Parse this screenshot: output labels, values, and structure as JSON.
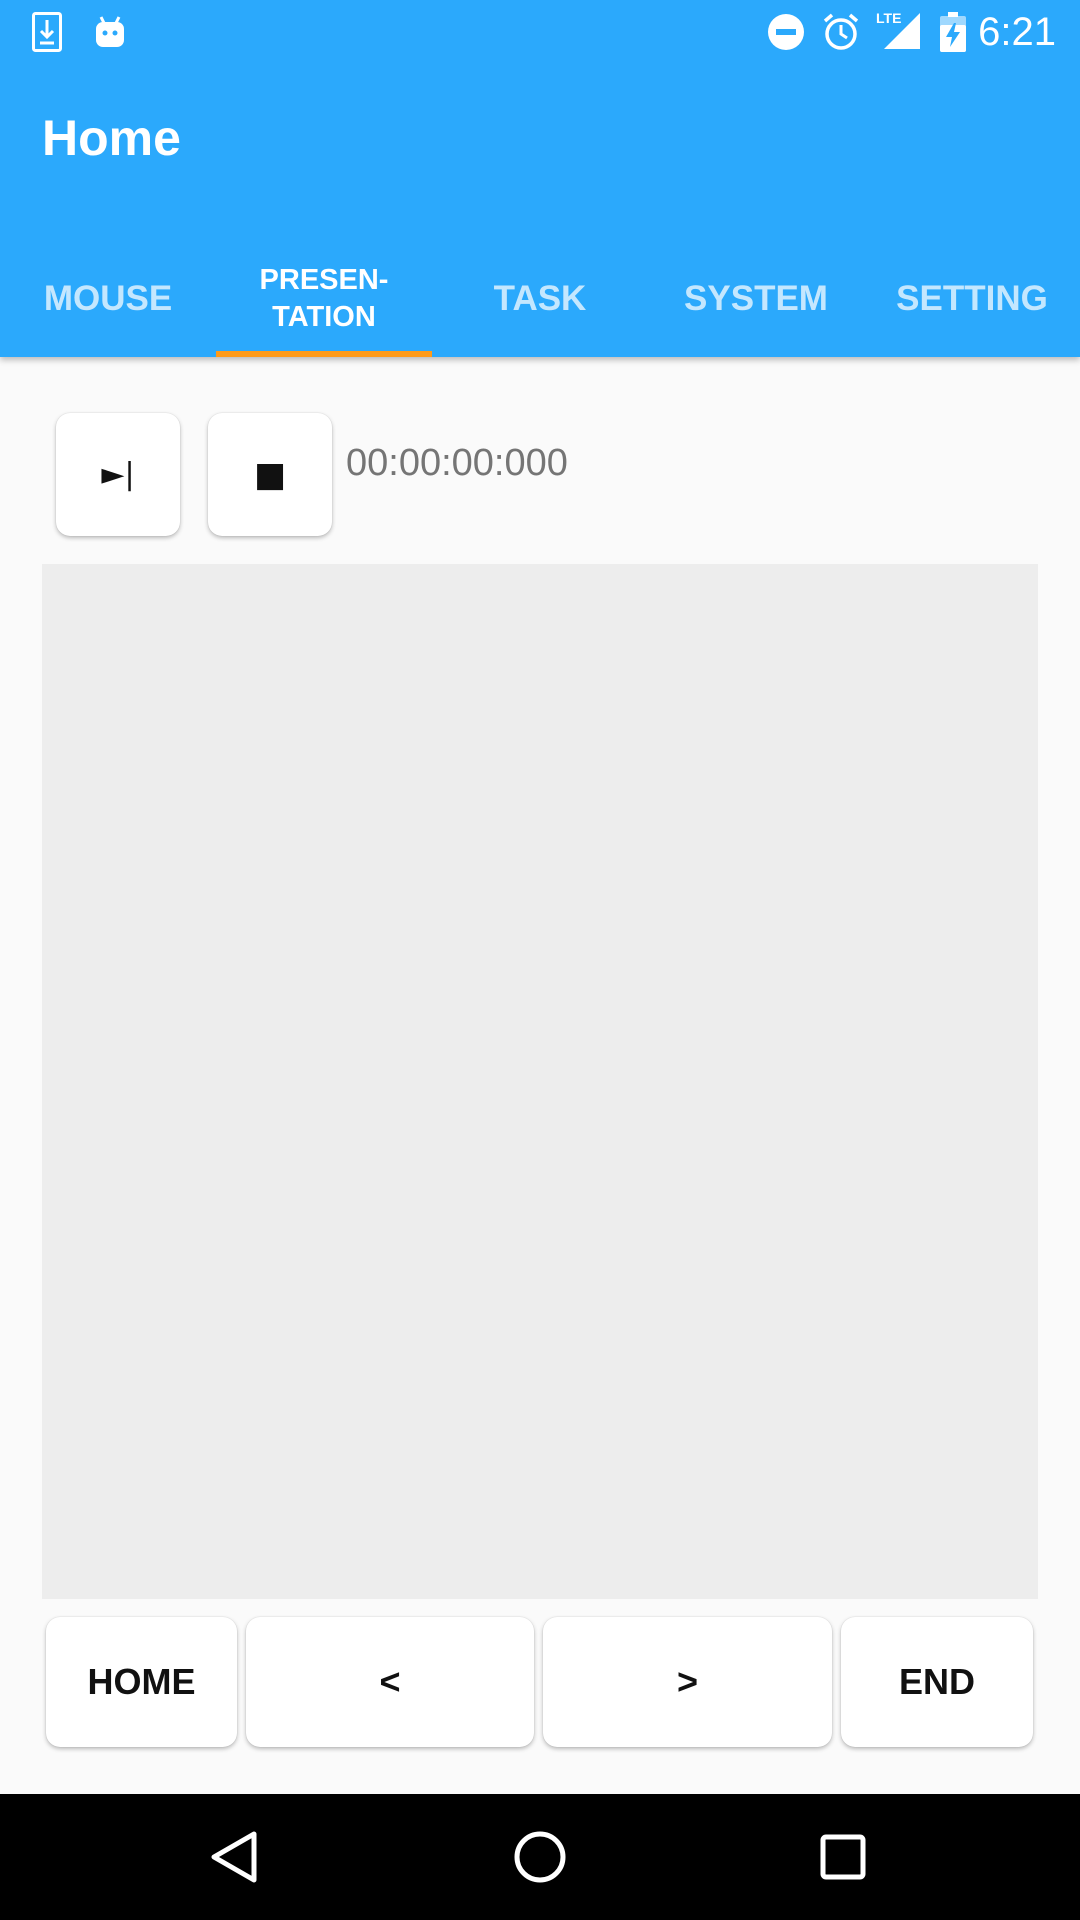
{
  "status_bar": {
    "time": "6:21",
    "network_label": "LTE",
    "icons": [
      "download-notification-icon",
      "android-notification-icon",
      "do-not-disturb-icon",
      "alarm-icon",
      "lte-signal-icon",
      "battery-charging-icon"
    ]
  },
  "app_bar": {
    "title": "Home",
    "background_color": "#2ba9fc",
    "tab_indicator_color": "#ff9b1a"
  },
  "tabs": [
    {
      "label": "MOUSE",
      "active": false
    },
    {
      "label": "PRESEN-\nTATION",
      "active": true
    },
    {
      "label": "TASK",
      "active": false
    },
    {
      "label": "SYSTEM",
      "active": false
    },
    {
      "label": "SETTING",
      "active": false
    }
  ],
  "presentation": {
    "start_button_icon": "play-skip-icon",
    "start_button_label": "►|",
    "stop_button_icon": "stop-icon",
    "stop_button_label": "■",
    "timer": "00:00:00:000",
    "touch_area_color": "#ededed"
  },
  "navigation_buttons": {
    "home": "HOME",
    "previous": "<",
    "next": ">",
    "end": "END"
  },
  "system_nav": {
    "icons": [
      "back-triangle-icon",
      "home-circle-icon",
      "recents-square-icon"
    ]
  }
}
